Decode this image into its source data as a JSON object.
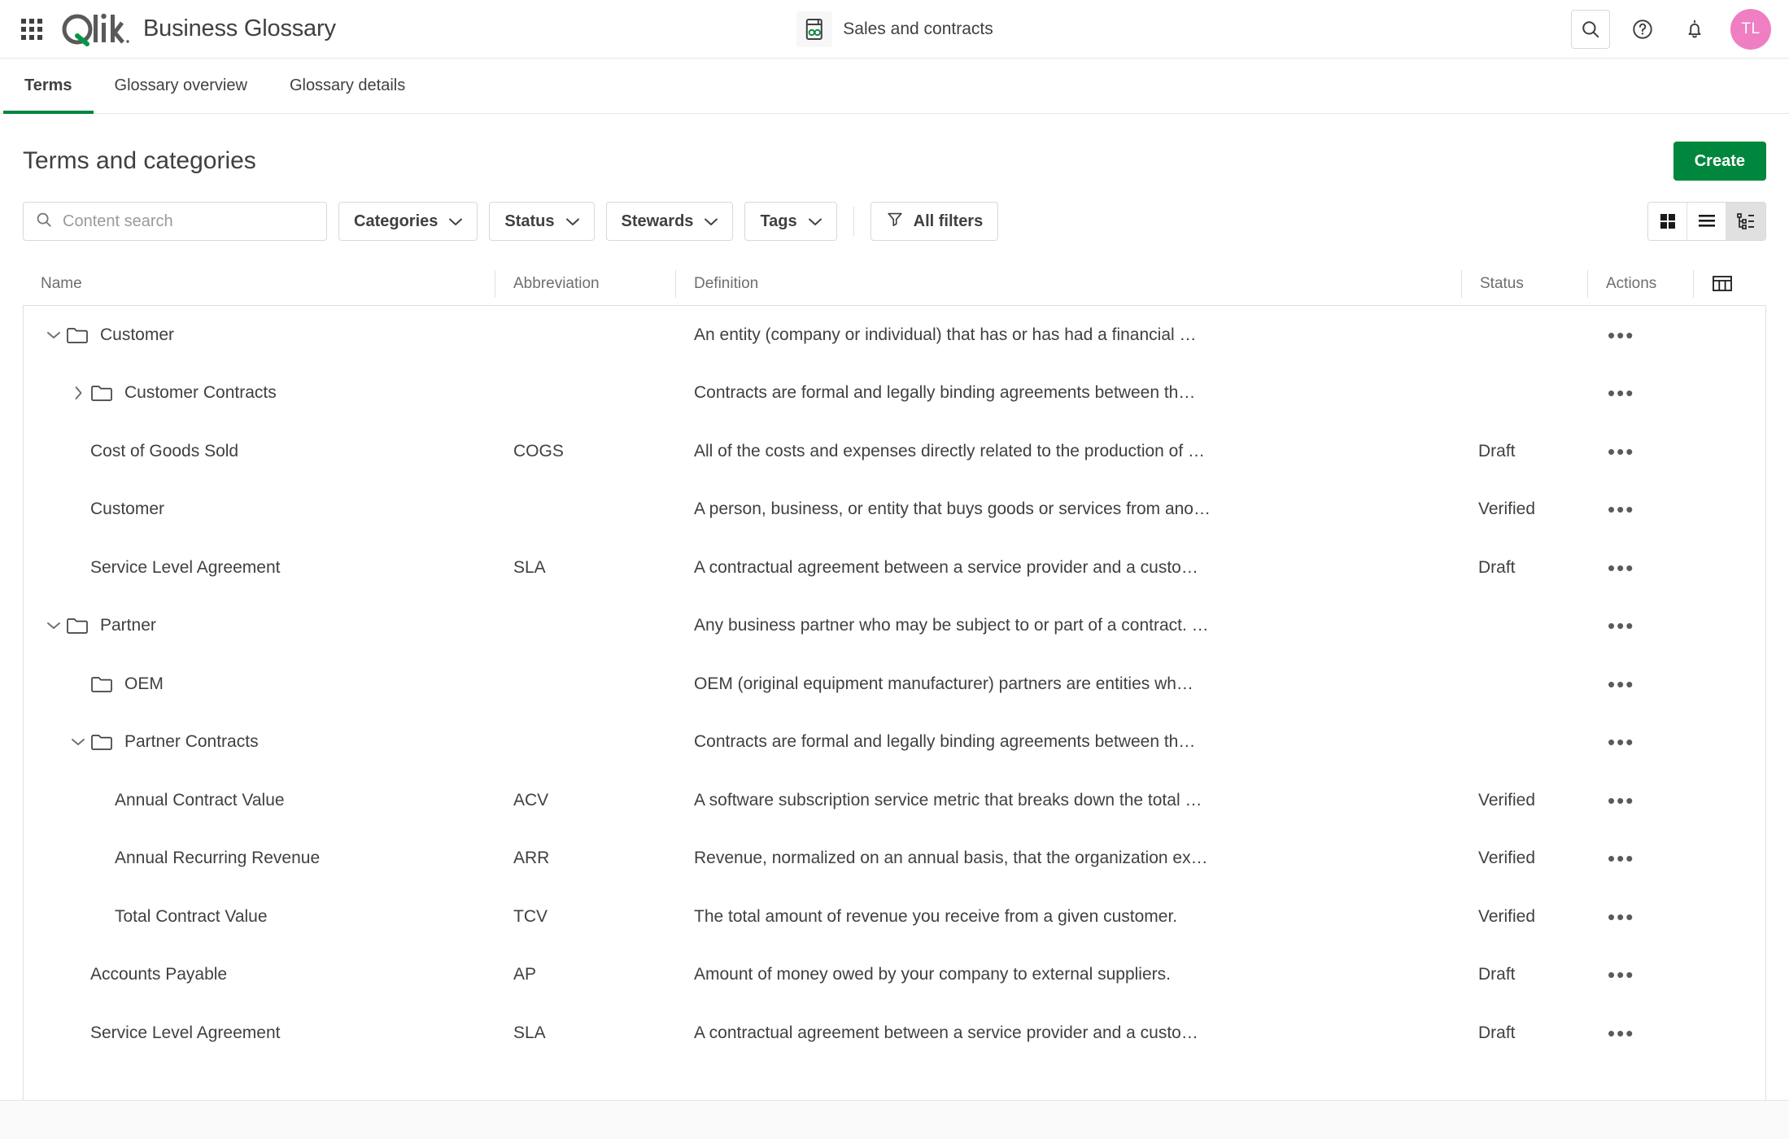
{
  "header": {
    "app_title": "Business Glossary",
    "waffle_icon": "app-launcher-icon",
    "logo_text": "Qlik",
    "space": {
      "icon": "glossary-icon",
      "name": "Sales and contracts"
    },
    "actions": {
      "search_icon": "search-icon",
      "help_icon": "help-circle-icon",
      "notifications_icon": "bell-icon",
      "avatar_initials": "TL",
      "avatar_color": "#ef7ec3"
    }
  },
  "tabs": [
    {
      "label": "Terms",
      "active": true
    },
    {
      "label": "Glossary overview",
      "active": false
    },
    {
      "label": "Glossary details",
      "active": false
    }
  ],
  "page": {
    "title": "Terms and categories",
    "create_label": "Create",
    "create_color": "#00873d"
  },
  "toolbar": {
    "search_placeholder": "Content search",
    "search_value": "",
    "filters": [
      {
        "label": "Categories"
      },
      {
        "label": "Status"
      },
      {
        "label": "Stewards"
      },
      {
        "label": "Tags"
      }
    ],
    "all_filters_label": "All filters",
    "views": [
      {
        "name": "grid-view",
        "active": false
      },
      {
        "name": "list-view",
        "active": false
      },
      {
        "name": "tree-view",
        "active": true
      }
    ]
  },
  "table": {
    "columns": {
      "name": "Name",
      "abbreviation": "Abbreviation",
      "definition": "Definition",
      "status": "Status",
      "actions": "Actions",
      "settings_icon": "table-columns-icon"
    },
    "rows": [
      {
        "name": "Customer",
        "type": "folder",
        "indent": 0,
        "expander": "down",
        "abbreviation": "",
        "definition": "An entity (company or individual) that has or has had a financial …",
        "status": "",
        "actions": "•••"
      },
      {
        "name": "Customer Contracts",
        "type": "folder",
        "indent": 1,
        "expander": "right",
        "abbreviation": "",
        "definition": "Contracts are formal and legally binding agreements between th…",
        "status": "",
        "actions": "•••"
      },
      {
        "name": "Cost of Goods Sold",
        "type": "term",
        "indent": 1,
        "expander": "none",
        "abbreviation": "COGS",
        "definition": "All of the costs and expenses directly related to the production of …",
        "status": "Draft",
        "actions": "•••"
      },
      {
        "name": "Customer",
        "type": "term",
        "indent": 1,
        "expander": "none",
        "abbreviation": "",
        "definition": "A person, business, or entity that buys goods or services from ano…",
        "status": "Verified",
        "actions": "•••"
      },
      {
        "name": "Service Level Agreement",
        "type": "term",
        "indent": 1,
        "expander": "none",
        "abbreviation": "SLA",
        "definition": "A contractual agreement between a service provider and a custo…",
        "status": "Draft",
        "actions": "•••"
      },
      {
        "name": "Partner",
        "type": "folder",
        "indent": 0,
        "expander": "down",
        "abbreviation": "",
        "definition": "Any business partner who may be subject to or part of a contract. …",
        "status": "",
        "actions": "•••"
      },
      {
        "name": "OEM",
        "type": "folder",
        "indent": 1,
        "expander": "none",
        "abbreviation": "",
        "definition": "OEM (original equipment manufacturer) partners are entities wh…",
        "status": "",
        "actions": "•••"
      },
      {
        "name": "Partner Contracts",
        "type": "folder",
        "indent": 1,
        "expander": "down",
        "abbreviation": "",
        "definition": "Contracts are formal and legally binding agreements between th…",
        "status": "",
        "actions": "•••"
      },
      {
        "name": "Annual Contract Value",
        "type": "term",
        "indent": 2,
        "expander": "none",
        "abbreviation": "ACV",
        "definition": "A software subscription service metric that breaks down the total …",
        "status": "Verified",
        "actions": "•••"
      },
      {
        "name": "Annual Recurring Revenue",
        "type": "term",
        "indent": 2,
        "expander": "none",
        "abbreviation": "ARR",
        "definition": "Revenue, normalized on an annual basis, that the organization ex…",
        "status": "Verified",
        "actions": "•••"
      },
      {
        "name": "Total Contract Value",
        "type": "term",
        "indent": 2,
        "expander": "none",
        "abbreviation": "TCV",
        "definition": "The total amount of revenue you receive from a given customer.",
        "status": "Verified",
        "actions": "•••"
      },
      {
        "name": "Accounts Payable",
        "type": "term",
        "indent": 1,
        "expander": "none",
        "abbreviation": "AP",
        "definition": "Amount of money owed by your company to external suppliers.",
        "status": "Draft",
        "actions": "•••"
      },
      {
        "name": "Service Level Agreement",
        "type": "term",
        "indent": 1,
        "expander": "none",
        "abbreviation": "SLA",
        "definition": "A contractual agreement between a service provider and a custo…",
        "status": "Draft",
        "actions": "•••"
      }
    ]
  }
}
